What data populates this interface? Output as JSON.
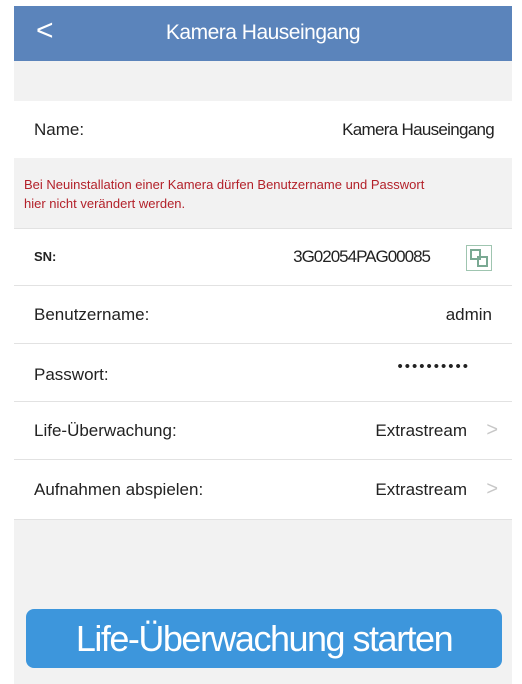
{
  "header": {
    "back_glyph": "<",
    "title": "Kamera Hauseingang"
  },
  "fields": {
    "name_label": "Name:",
    "name_value": "Kamera Hauseingang",
    "notice": "Bei Neuinstallation einer Kamera dürfen Benutzername und Passwort hier nicht verändert werden.",
    "sn_label": "SN:",
    "sn_value": "3G02054PAG00085",
    "user_label": "Benutzername:",
    "user_value": "admin",
    "pass_label": "Passwort:",
    "pass_value": "••••••••••",
    "live_label": "Life-Überwachung:",
    "live_value": "Extrastream",
    "playback_label": "Aufnahmen abspielen:",
    "playback_value": "Extrastream"
  },
  "icons": {
    "qr": "qr-code-icon",
    "chevron": "chevron-right-icon",
    "chevron_glyph": ">"
  },
  "button": {
    "start_label": "Life-Überwachung starten"
  },
  "colors": {
    "header": "#5b84bb",
    "notice_text": "#b3212a",
    "button": "#3d96dc"
  }
}
